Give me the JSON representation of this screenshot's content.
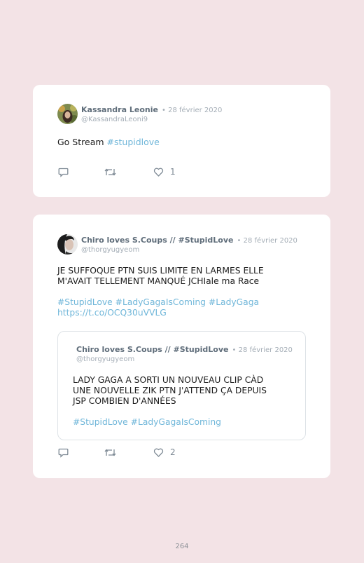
{
  "tweets": [
    {
      "author": "Kassandra Leonie",
      "date": "• 28 février 2020",
      "handle": "@KassandraLeoni9",
      "text": "Go Stream ",
      "hashtag": "#stupidlove",
      "likes": "1"
    },
    {
      "author": "Chiro loves S.Coups // #StupidLove",
      "date": "• 28 février 2020",
      "handle": "@thorgyugyeom",
      "line1": "JE SUFFOQUE PTN SUIS LIMITE EN LARMES ELLE",
      "line2": "M'AVAIT TELLEMENT MANQUÉ JCHIale ma Race",
      "hashtags": "#StupidLove #LadyGagaIsComing #LadyGaga",
      "url": "https://t.co/OCQ30uVVLG",
      "likes": "2",
      "quote": {
        "author": "Chiro loves S.Coups // #StupidLove",
        "date": "• 28 février 2020",
        "handle": "@thorgyugyeom",
        "line1": "LADY GAGA A SORTI UN NOUVEAU CLIP CÀD",
        "line2": "UNE NOUVELLE ZIK PTN J'ATTEND ÇA DEPUIS",
        "line3": "JSP COMBIEN D'ANNÉES",
        "hashtags": "#StupidLove #LadyGagaIsComing"
      }
    }
  ],
  "page_number": "264",
  "icons": [
    "reply-icon",
    "retweet-icon",
    "heart-icon"
  ]
}
